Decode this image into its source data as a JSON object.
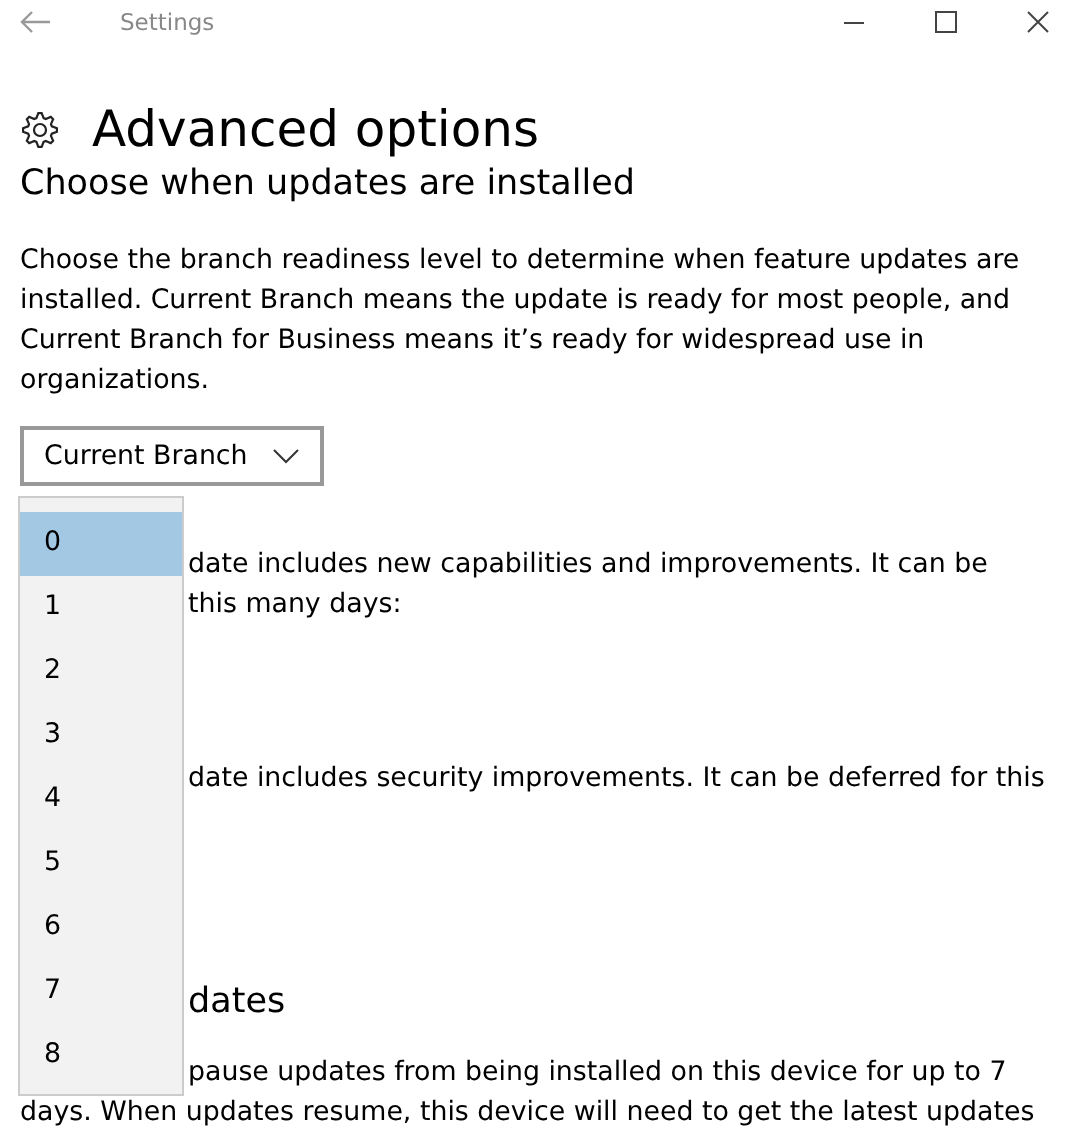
{
  "window": {
    "title": "Settings"
  },
  "page": {
    "title": "Advanced options",
    "section_title": "Choose when updates are installed",
    "description": "Choose the branch readiness level to determine when feature updates are installed. Current Branch means the update is ready for most people, and Current Branch for Business means it’s ready for widespread use in organizations."
  },
  "branch_dropdown": {
    "value": "Current Branch"
  },
  "deferral_dropdown": {
    "options": [
      {
        "label": "0",
        "selected": true
      },
      {
        "label": "1",
        "selected": false
      },
      {
        "label": "2",
        "selected": false
      },
      {
        "label": "3",
        "selected": false
      },
      {
        "label": "4",
        "selected": false
      },
      {
        "label": "5",
        "selected": false
      },
      {
        "label": "6",
        "selected": false
      },
      {
        "label": "7",
        "selected": false
      },
      {
        "label": "8",
        "selected": false
      }
    ]
  },
  "covered_texts": [
    {
      "kind": "line",
      "text": "date includes new capabilities and improvements. It can be"
    },
    {
      "kind": "line",
      "text": "this many days:"
    },
    {
      "kind": "gap"
    },
    {
      "kind": "line",
      "text": "date includes security improvements. It can be deferred for this"
    },
    {
      "kind": "gap"
    },
    {
      "kind": "heading",
      "text": "dates"
    },
    {
      "kind": "line",
      "text": "pause updates from being installed on this device for up to 7"
    }
  ],
  "trailing_text": "days. When updates resume, this device will need to get the latest updates"
}
